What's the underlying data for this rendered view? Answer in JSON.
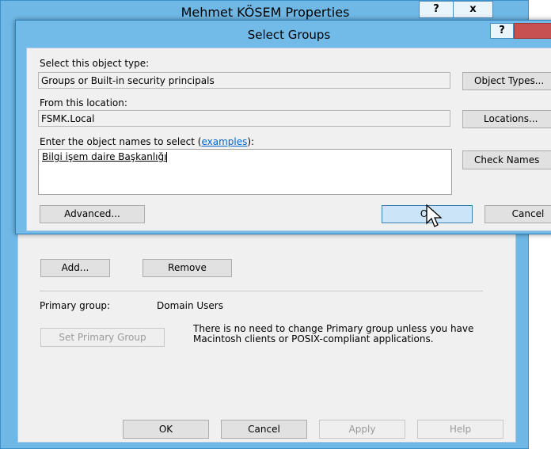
{
  "props_window": {
    "title": "Mehmet KÖSEM Properties",
    "help_glyph": "?",
    "close_glyph": "x",
    "add_label": "Add...",
    "remove_label": "Remove",
    "primary_group_label": "Primary group:",
    "primary_group_value": "Domain Users",
    "set_primary_label": "Set Primary Group",
    "note": "There is no need to change Primary group unless you have Macintosh clients or POSIX-compliant applications.",
    "ok_label": "OK",
    "cancel_label": "Cancel",
    "apply_label": "Apply",
    "help_label": "Help"
  },
  "select_groups": {
    "title": "Select Groups",
    "help_glyph": "?",
    "object_type_label": "Select this object type:",
    "object_type_value": "Groups or Built-in security principals",
    "object_types_button": "Object Types...",
    "location_label": "From this location:",
    "location_value": "FSMK.Local",
    "locations_button": "Locations...",
    "names_label_prefix": "Enter the object names to select (",
    "names_label_link": "examples",
    "names_label_suffix": "):",
    "names_value": "Bilgi işem daire Başkanlığı",
    "check_names_button": "Check Names",
    "advanced_button": "Advanced...",
    "ok_button": "OK",
    "cancel_button": "Cancel"
  },
  "colors": {
    "title_bar": "#72bbe8",
    "close_red": "#c75050",
    "ok_focus": "#cce4f7",
    "link": "#0066cc"
  }
}
